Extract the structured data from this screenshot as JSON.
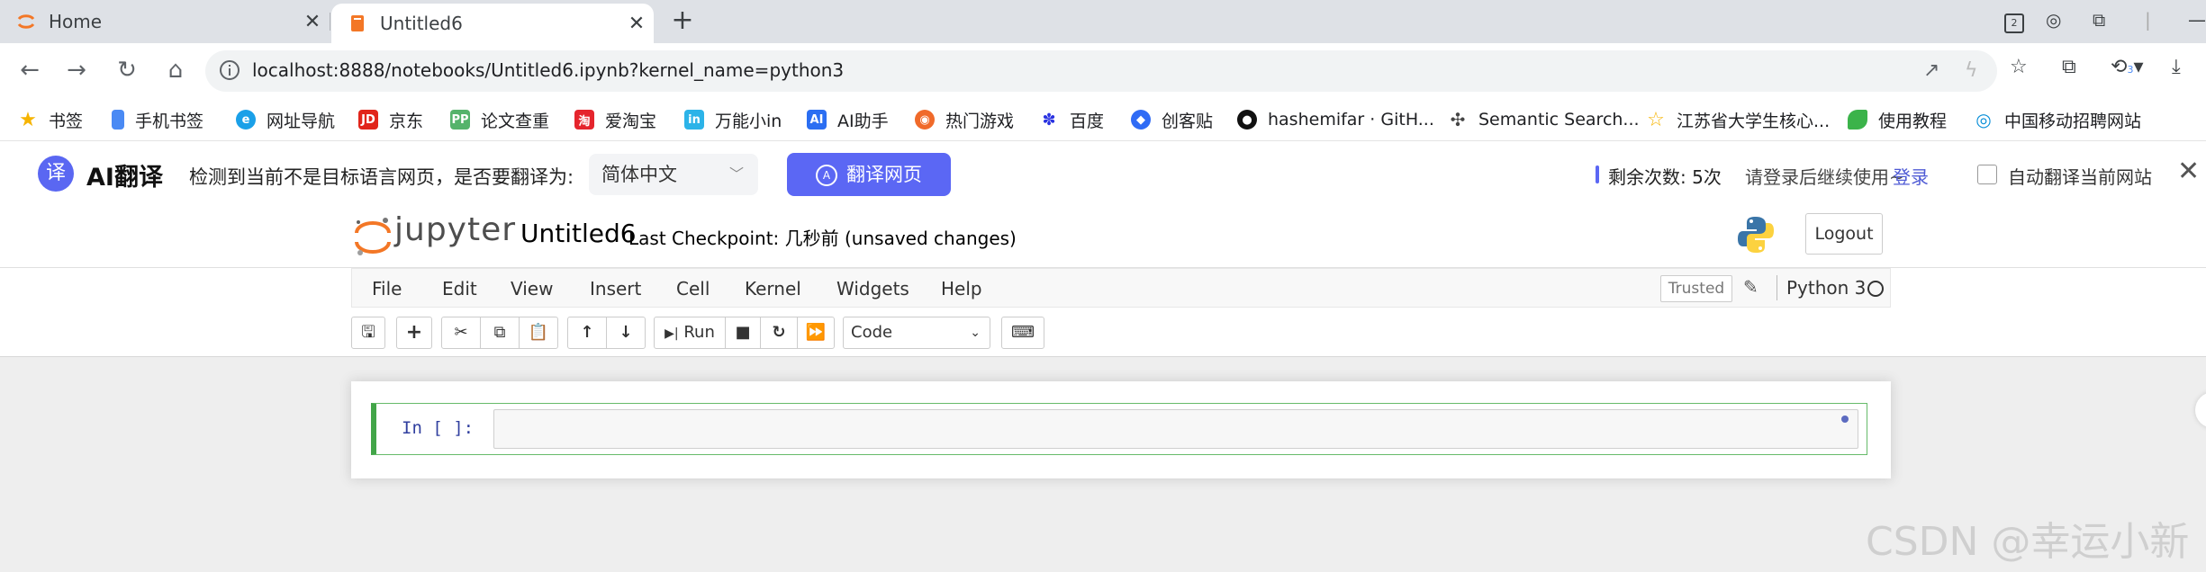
{
  "browser": {
    "tabs": [
      {
        "label": "Home",
        "icon": "jupyter-favicon"
      },
      {
        "label": "Untitled6",
        "icon": "notebook-favicon"
      }
    ],
    "address": {
      "url": "localhost:8888/notebooks/Untitled6.ipynb?kernel_name=python3"
    },
    "profile_badge": "3"
  },
  "bookmarks": [
    {
      "label": "书签",
      "icon": "star-icon",
      "color": "#f6b400"
    },
    {
      "label": "手机书签",
      "icon": "phone-icon",
      "color": "#4a8af4"
    },
    {
      "label": "网址导航",
      "icon": "nav-icon",
      "color": "#1aa0e8"
    },
    {
      "label": "京东",
      "icon": "jd-icon",
      "color": "#e1251b"
    },
    {
      "label": "论文查重",
      "icon": "pp-icon",
      "color": "#55b36b"
    },
    {
      "label": "爱淘宝",
      "icon": "taobao-icon",
      "color": "#e5252d"
    },
    {
      "label": "万能小in",
      "icon": "in-icon",
      "color": "#2cb3e8"
    },
    {
      "label": "AI助手",
      "icon": "ai-icon",
      "color": "#2b6ef2"
    },
    {
      "label": "热门游戏",
      "icon": "game-icon",
      "color": "#f06a2a"
    },
    {
      "label": "百度",
      "icon": "baidu-icon",
      "color": "#2932e1"
    },
    {
      "label": "创客贴",
      "icon": "chuangke-icon",
      "color": "#2f6bf5"
    },
    {
      "label": "hashemifar · GitH...",
      "icon": "github-icon",
      "color": "#111111"
    },
    {
      "label": "Semantic Search...",
      "icon": "semantic-icon",
      "color": "#444444"
    },
    {
      "label": "江苏省大学生核心...",
      "icon": "star-outline-icon",
      "color": "#f6b400"
    },
    {
      "label": "使用教程",
      "icon": "leaf-icon",
      "color": "#3bb34a"
    },
    {
      "label": "中国移动招聘网站",
      "icon": "cmcc-icon",
      "color": "#0a8fd8"
    }
  ],
  "translate": {
    "brand": "AI翻译",
    "logo_char": "译",
    "prompt": "检测到当前不是目标语言网页，是否要翻译为:",
    "language": "简体中文",
    "button": "翻译网页",
    "remaining": "剩余次数:  5次",
    "login_tip": "请登录后继续使用~",
    "login": "登录",
    "auto_label": "自动翻译当前网站",
    "accent": "#5b67f4"
  },
  "jupyter": {
    "logo_text": "jupyter",
    "notebook_name": "Untitled6",
    "checkpoint": "Last Checkpoint: 几秒前  (unsaved changes)",
    "logout": "Logout",
    "menu": [
      "File",
      "Edit",
      "View",
      "Insert",
      "Cell",
      "Kernel",
      "Widgets",
      "Help"
    ],
    "trusted": "Trusted",
    "kernel": "Python 3",
    "toolbar": {
      "run_label": "Run",
      "cell_type": "Code"
    },
    "cell": {
      "prompt": "In [ ]:"
    }
  },
  "watermark": "CSDN @幸运小新"
}
